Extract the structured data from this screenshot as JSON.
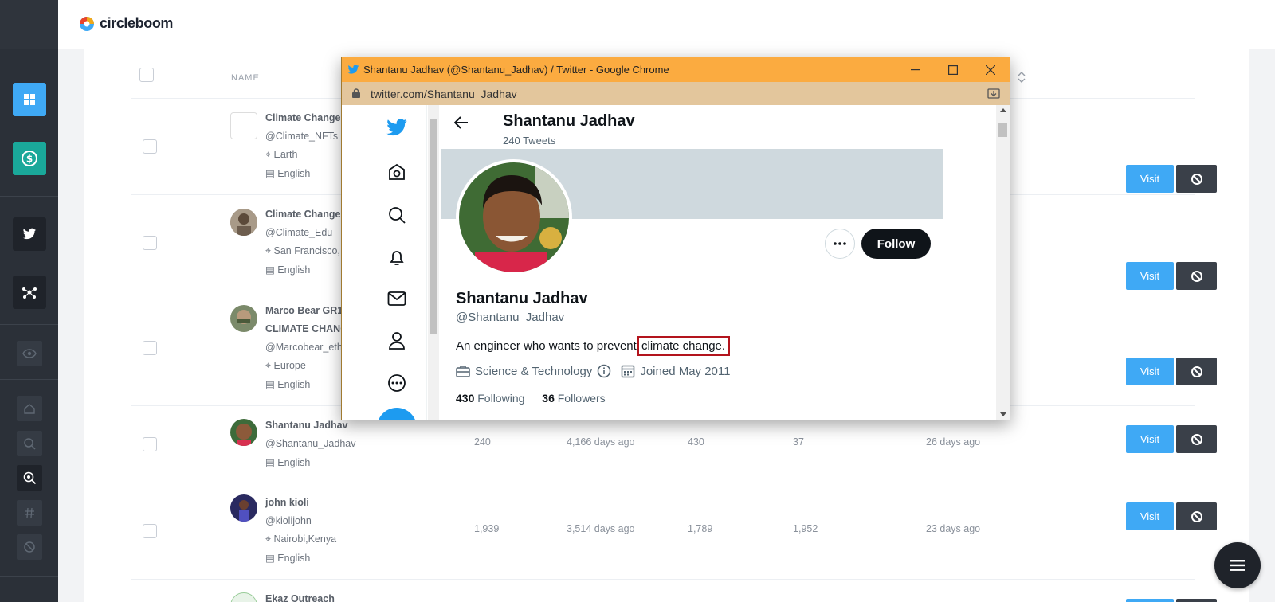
{
  "app": {
    "logo_text": "circleboom",
    "colors": {
      "accent_blue": "#3fa9f5",
      "teal": "#1aa89a",
      "sidebar": "#2b3038",
      "chrome_title": "#fbab40",
      "highlight": "#b3141d"
    }
  },
  "sidebar": {
    "icons": [
      "dashboard-icon",
      "dollar-icon",
      "twitter-icon",
      "network-icon",
      "eye-icon",
      "home-icon",
      "search-icon",
      "zoom-search-icon",
      "hashtag-icon",
      "block-icon"
    ]
  },
  "table": {
    "header_name": "NAME",
    "rows": [
      {
        "name": "Climate Change",
        "handle": "@Climate_NFTs",
        "location": "Earth",
        "language": "English",
        "tweets": "",
        "age": "",
        "following": "",
        "followers": "",
        "last": ""
      },
      {
        "name": "Climate Change",
        "handle": "@Climate_Edu",
        "location": "San Francisco,",
        "language": "English",
        "tweets": "",
        "age": "",
        "following": "",
        "followers": "",
        "last": ""
      },
      {
        "name": "Marco Bear GR1",
        "name2": "CLIMATE CHANG",
        "handle": "@Marcobear_eth",
        "location": "Europe",
        "language": "English",
        "tweets": "",
        "age": "",
        "following": "",
        "followers": "",
        "last": ""
      },
      {
        "name": "Shantanu Jadhav",
        "handle": "@Shantanu_Jadhav",
        "location": "",
        "language": "English",
        "tweets": "240",
        "age": "4,166 days ago",
        "following": "430",
        "followers": "37",
        "last": "26 days ago"
      },
      {
        "name": "john kioli",
        "handle": "@kiolijohn",
        "location": "Nairobi,Kenya",
        "language": "English",
        "tweets": "1,939",
        "age": "3,514 days ago",
        "following": "1,789",
        "followers": "1,952",
        "last": "23 days ago"
      },
      {
        "name": "Ekaz Outreach"
      }
    ],
    "visit_label": "Visit"
  },
  "popup": {
    "window_title": "Shantanu Jadhav (@Shantanu_Jadhav) / Twitter - Google Chrome",
    "url": "twitter.com/Shantanu_Jadhav",
    "profile": {
      "header_name": "Shantanu Jadhav",
      "header_tweets": "240 Tweets",
      "name": "Shantanu Jadhav",
      "handle": "@Shantanu_Jadhav",
      "bio_before": "An engineer who wants to prevent ",
      "bio_highlight": "climate change.",
      "category": "Science & Technology",
      "joined": "Joined May 2011",
      "following_count": "430",
      "following_label": "Following",
      "followers_count": "36",
      "followers_label": "Followers",
      "follow_label": "Follow"
    }
  }
}
